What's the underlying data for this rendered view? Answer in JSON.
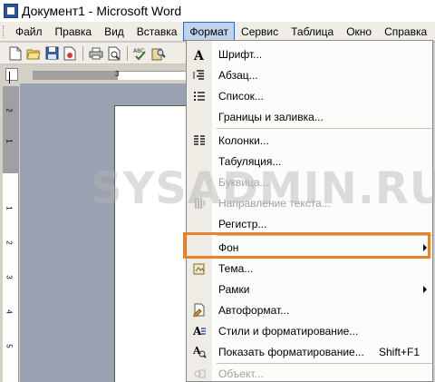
{
  "window": {
    "title": "Документ1 - Microsoft Word"
  },
  "menubar": {
    "items": [
      {
        "label": "Файл"
      },
      {
        "label": "Правка"
      },
      {
        "label": "Вид"
      },
      {
        "label": "Вставка"
      },
      {
        "label": "Формат",
        "active": true
      },
      {
        "label": "Сервис"
      },
      {
        "label": "Таблица"
      },
      {
        "label": "Окно"
      },
      {
        "label": "Справка"
      }
    ]
  },
  "toolbar": {
    "buttons": [
      "new-doc-icon",
      "open-folder-icon",
      "save-icon",
      "permission-icon",
      "print-icon",
      "print-preview-icon",
      "spelling-icon",
      "research-icon"
    ]
  },
  "ruler": {
    "h_label": "3",
    "v_labels": [
      "2",
      "1",
      "1",
      "2",
      "3",
      "4",
      "5"
    ]
  },
  "watermark": "SYSADMIN.RU",
  "format_menu": {
    "items": [
      {
        "label": "Шрифт...",
        "icon": "font-icon"
      },
      {
        "label": "Абзац...",
        "icon": "paragraph-icon"
      },
      {
        "label": "Список...",
        "icon": "list-icon"
      },
      {
        "label": "Границы и заливка...",
        "icon": ""
      },
      {
        "label": "Колонки...",
        "icon": "columns-icon"
      },
      {
        "label": "Табуляция...",
        "icon": ""
      },
      {
        "label": "Буквица...",
        "icon": "",
        "disabled": true
      },
      {
        "label": "Направление текста...",
        "icon": "text-direction-icon",
        "disabled": true
      },
      {
        "label": "Регистр...",
        "icon": ""
      },
      {
        "label": "Фон",
        "icon": "",
        "submenu": true
      },
      {
        "label": "Тема...",
        "icon": "theme-icon"
      },
      {
        "label": "Рамки",
        "icon": "",
        "submenu": true
      },
      {
        "label": "Автоформат...",
        "icon": "autoformat-icon"
      },
      {
        "label": "Стили и форматирование...",
        "icon": "styles-icon"
      },
      {
        "label": "Показать форматирование...",
        "icon": "reveal-format-icon",
        "shortcut": "Shift+F1"
      },
      {
        "label": "Объект...",
        "icon": "object-icon",
        "disabled": true
      }
    ]
  },
  "colors": {
    "highlight": "#e8822d",
    "menu_active": "#c1d2ee"
  }
}
